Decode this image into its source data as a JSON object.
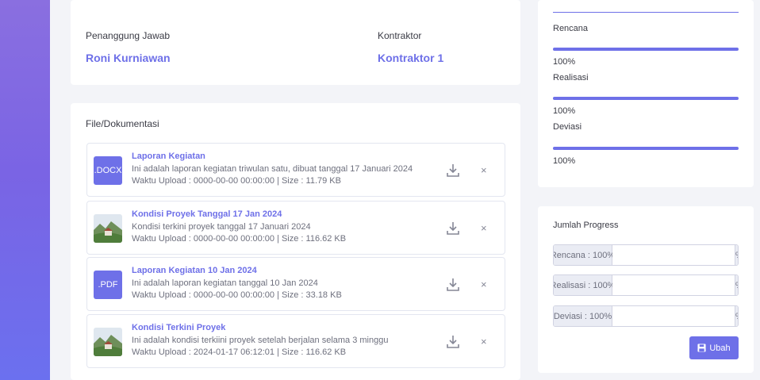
{
  "responsible": {
    "pj_label": "Penanggung Jawab",
    "pj_value": "Roni Kurniawan",
    "kontraktor_label": "Kontraktor",
    "kontraktor_value": "Kontraktor 1"
  },
  "files": {
    "title": "File/Dokumentasi",
    "items": [
      {
        "type": ".DOCX",
        "name": "Laporan Kegiatan",
        "desc": "Ini adalah laporan kegiatan triwulan satu, dibuat tanggal 17 Januari 2024",
        "meta": "Waktu Upload : 0000-00-00 00:00:00 | Size : 11.79 KB",
        "remove": "×"
      },
      {
        "type": "image",
        "name": "Kondisi Proyek Tanggal 17 Jan 2024",
        "desc": "Kondisi terkini proyek tanggal 17 Januari 2024",
        "meta": "Waktu Upload : 0000-00-00 00:00:00 | Size : 116.62 KB",
        "remove": "×"
      },
      {
        "type": ".PDF",
        "name": "Laporan Kegiatan 10 Jan 2024",
        "desc": "Ini adalah laporan kegiatan tanggal 10 Jan 2024",
        "meta": "Waktu Upload : 0000-00-00 00:00:00 | Size : 33.18 KB",
        "remove": "×"
      },
      {
        "type": "image",
        "name": "Kondisi Terkini Proyek",
        "desc": "Ini adalah kondisi terkiini proyek setelah berjalan selama 3 minggu",
        "meta": "Waktu Upload : 2024-01-17 06:12:01 | Size : 116.62 KB",
        "remove": "×"
      }
    ]
  },
  "progress": {
    "items": [
      {
        "label": "Rencana",
        "percent": "100%",
        "fill": 1.0
      },
      {
        "label": "Realisasi",
        "percent": "100%",
        "fill": 1.0
      },
      {
        "label": "Deviasi",
        "percent": "100%",
        "fill": 1.0
      }
    ]
  },
  "jumlah": {
    "title": "Jumlah Progress",
    "rows": [
      {
        "prefix": "Rencana : 100%",
        "value": "",
        "suffix": "%"
      },
      {
        "prefix": "Realisasi : 100%",
        "value": "",
        "suffix": "%"
      },
      {
        "prefix": "Deviasi : 100%",
        "value": "",
        "suffix": "%"
      }
    ],
    "button_label": "Ubah"
  },
  "colors": {
    "accent": "#6e70e8",
    "sidebar": "#7a64e4"
  }
}
